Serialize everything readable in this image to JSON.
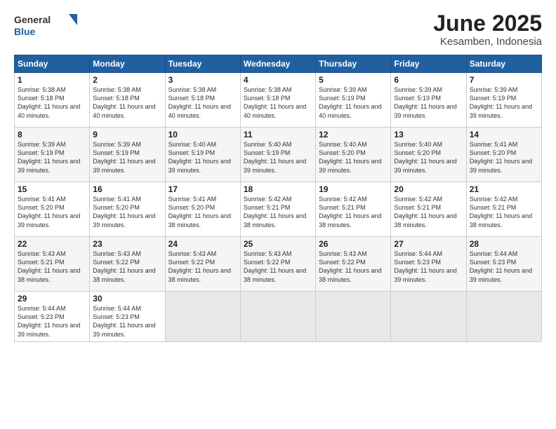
{
  "header": {
    "logo_general": "General",
    "logo_blue": "Blue",
    "title": "June 2025",
    "subtitle": "Kesamben, Indonesia"
  },
  "days_of_week": [
    "Sunday",
    "Monday",
    "Tuesday",
    "Wednesday",
    "Thursday",
    "Friday",
    "Saturday"
  ],
  "weeks": [
    [
      {
        "day": "1",
        "info": "Sunrise: 5:38 AM\nSunset: 5:18 PM\nDaylight: 11 hours\nand 40 minutes."
      },
      {
        "day": "2",
        "info": "Sunrise: 5:38 AM\nSunset: 5:18 PM\nDaylight: 11 hours\nand 40 minutes."
      },
      {
        "day": "3",
        "info": "Sunrise: 5:38 AM\nSunset: 5:18 PM\nDaylight: 11 hours\nand 40 minutes."
      },
      {
        "day": "4",
        "info": "Sunrise: 5:38 AM\nSunset: 5:18 PM\nDaylight: 11 hours\nand 40 minutes."
      },
      {
        "day": "5",
        "info": "Sunrise: 5:39 AM\nSunset: 5:19 PM\nDaylight: 11 hours\nand 40 minutes."
      },
      {
        "day": "6",
        "info": "Sunrise: 5:39 AM\nSunset: 5:19 PM\nDaylight: 11 hours\nand 39 minutes."
      },
      {
        "day": "7",
        "info": "Sunrise: 5:39 AM\nSunset: 5:19 PM\nDaylight: 11 hours\nand 39 minutes."
      }
    ],
    [
      {
        "day": "8",
        "info": "Sunrise: 5:39 AM\nSunset: 5:19 PM\nDaylight: 11 hours\nand 39 minutes."
      },
      {
        "day": "9",
        "info": "Sunrise: 5:39 AM\nSunset: 5:19 PM\nDaylight: 11 hours\nand 39 minutes."
      },
      {
        "day": "10",
        "info": "Sunrise: 5:40 AM\nSunset: 5:19 PM\nDaylight: 11 hours\nand 39 minutes."
      },
      {
        "day": "11",
        "info": "Sunrise: 5:40 AM\nSunset: 5:19 PM\nDaylight: 11 hours\nand 39 minutes."
      },
      {
        "day": "12",
        "info": "Sunrise: 5:40 AM\nSunset: 5:20 PM\nDaylight: 11 hours\nand 39 minutes."
      },
      {
        "day": "13",
        "info": "Sunrise: 5:40 AM\nSunset: 5:20 PM\nDaylight: 11 hours\nand 39 minutes."
      },
      {
        "day": "14",
        "info": "Sunrise: 5:41 AM\nSunset: 5:20 PM\nDaylight: 11 hours\nand 39 minutes."
      }
    ],
    [
      {
        "day": "15",
        "info": "Sunrise: 5:41 AM\nSunset: 5:20 PM\nDaylight: 11 hours\nand 39 minutes."
      },
      {
        "day": "16",
        "info": "Sunrise: 5:41 AM\nSunset: 5:20 PM\nDaylight: 11 hours\nand 39 minutes."
      },
      {
        "day": "17",
        "info": "Sunrise: 5:41 AM\nSunset: 5:20 PM\nDaylight: 11 hours\nand 38 minutes."
      },
      {
        "day": "18",
        "info": "Sunrise: 5:42 AM\nSunset: 5:21 PM\nDaylight: 11 hours\nand 38 minutes."
      },
      {
        "day": "19",
        "info": "Sunrise: 5:42 AM\nSunset: 5:21 PM\nDaylight: 11 hours\nand 38 minutes."
      },
      {
        "day": "20",
        "info": "Sunrise: 5:42 AM\nSunset: 5:21 PM\nDaylight: 11 hours\nand 38 minutes."
      },
      {
        "day": "21",
        "info": "Sunrise: 5:42 AM\nSunset: 5:21 PM\nDaylight: 11 hours\nand 38 minutes."
      }
    ],
    [
      {
        "day": "22",
        "info": "Sunrise: 5:43 AM\nSunset: 5:21 PM\nDaylight: 11 hours\nand 38 minutes."
      },
      {
        "day": "23",
        "info": "Sunrise: 5:43 AM\nSunset: 5:22 PM\nDaylight: 11 hours\nand 38 minutes."
      },
      {
        "day": "24",
        "info": "Sunrise: 5:43 AM\nSunset: 5:22 PM\nDaylight: 11 hours\nand 38 minutes."
      },
      {
        "day": "25",
        "info": "Sunrise: 5:43 AM\nSunset: 5:22 PM\nDaylight: 11 hours\nand 38 minutes."
      },
      {
        "day": "26",
        "info": "Sunrise: 5:43 AM\nSunset: 5:22 PM\nDaylight: 11 hours\nand 38 minutes."
      },
      {
        "day": "27",
        "info": "Sunrise: 5:44 AM\nSunset: 5:23 PM\nDaylight: 11 hours\nand 39 minutes."
      },
      {
        "day": "28",
        "info": "Sunrise: 5:44 AM\nSunset: 5:23 PM\nDaylight: 11 hours\nand 39 minutes."
      }
    ],
    [
      {
        "day": "29",
        "info": "Sunrise: 5:44 AM\nSunset: 5:23 PM\nDaylight: 11 hours\nand 39 minutes."
      },
      {
        "day": "30",
        "info": "Sunrise: 5:44 AM\nSunset: 5:23 PM\nDaylight: 11 hours\nand 39 minutes."
      },
      {
        "day": "",
        "info": ""
      },
      {
        "day": "",
        "info": ""
      },
      {
        "day": "",
        "info": ""
      },
      {
        "day": "",
        "info": ""
      },
      {
        "day": "",
        "info": ""
      }
    ]
  ]
}
